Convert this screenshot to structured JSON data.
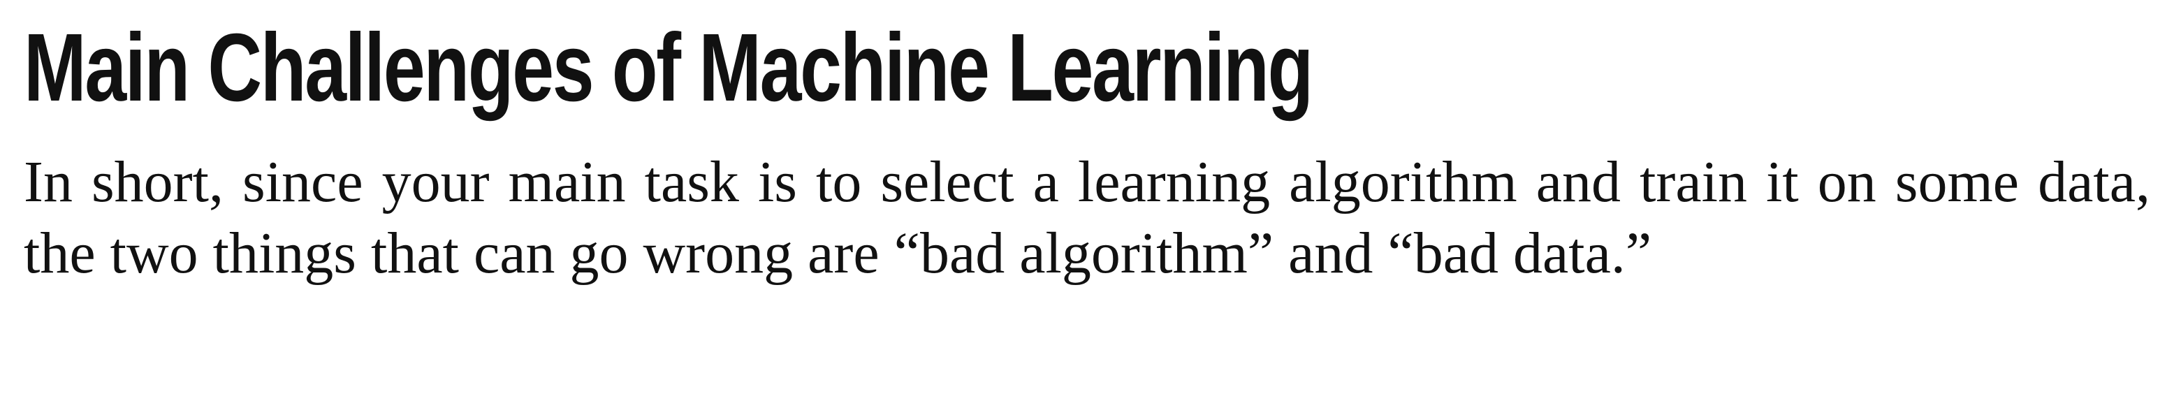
{
  "section": {
    "title": "Main Challenges of Machine Learning",
    "paragraph": "In short, since your main task is to select a learning algorithm and train it on some data, the two things that can go wrong are “bad algorithm” and “bad data.”"
  }
}
